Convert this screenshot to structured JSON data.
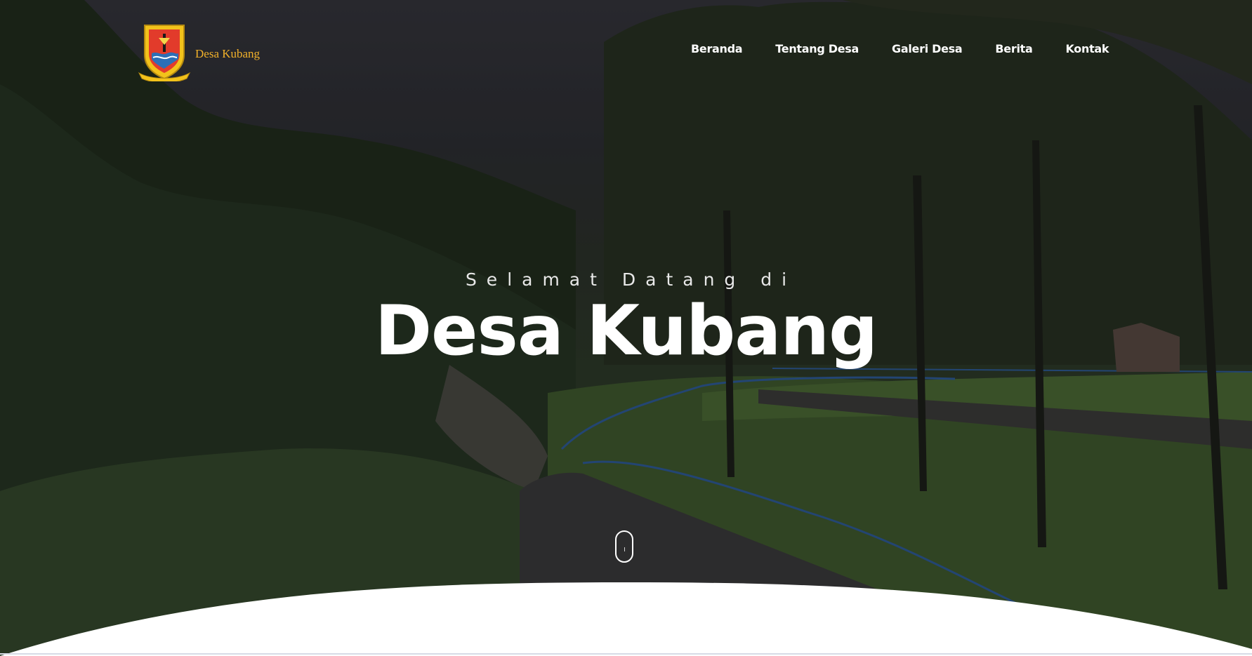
{
  "brand": {
    "name": "Desa Kubang",
    "logo_icon": "village-crest-icon"
  },
  "nav": {
    "items": [
      {
        "label": "Beranda"
      },
      {
        "label": "Tentang Desa"
      },
      {
        "label": "Galeri Desa"
      },
      {
        "label": "Berita"
      },
      {
        "label": "Kontak"
      }
    ]
  },
  "hero": {
    "subtitle": "Selamat Datang di",
    "title": "Desa Kubang",
    "scroll_icon": "mouse-scroll-icon"
  },
  "colors": {
    "brand_text": "#f2b12a",
    "nav_text": "#ffffff",
    "title_text": "#ffffff"
  }
}
